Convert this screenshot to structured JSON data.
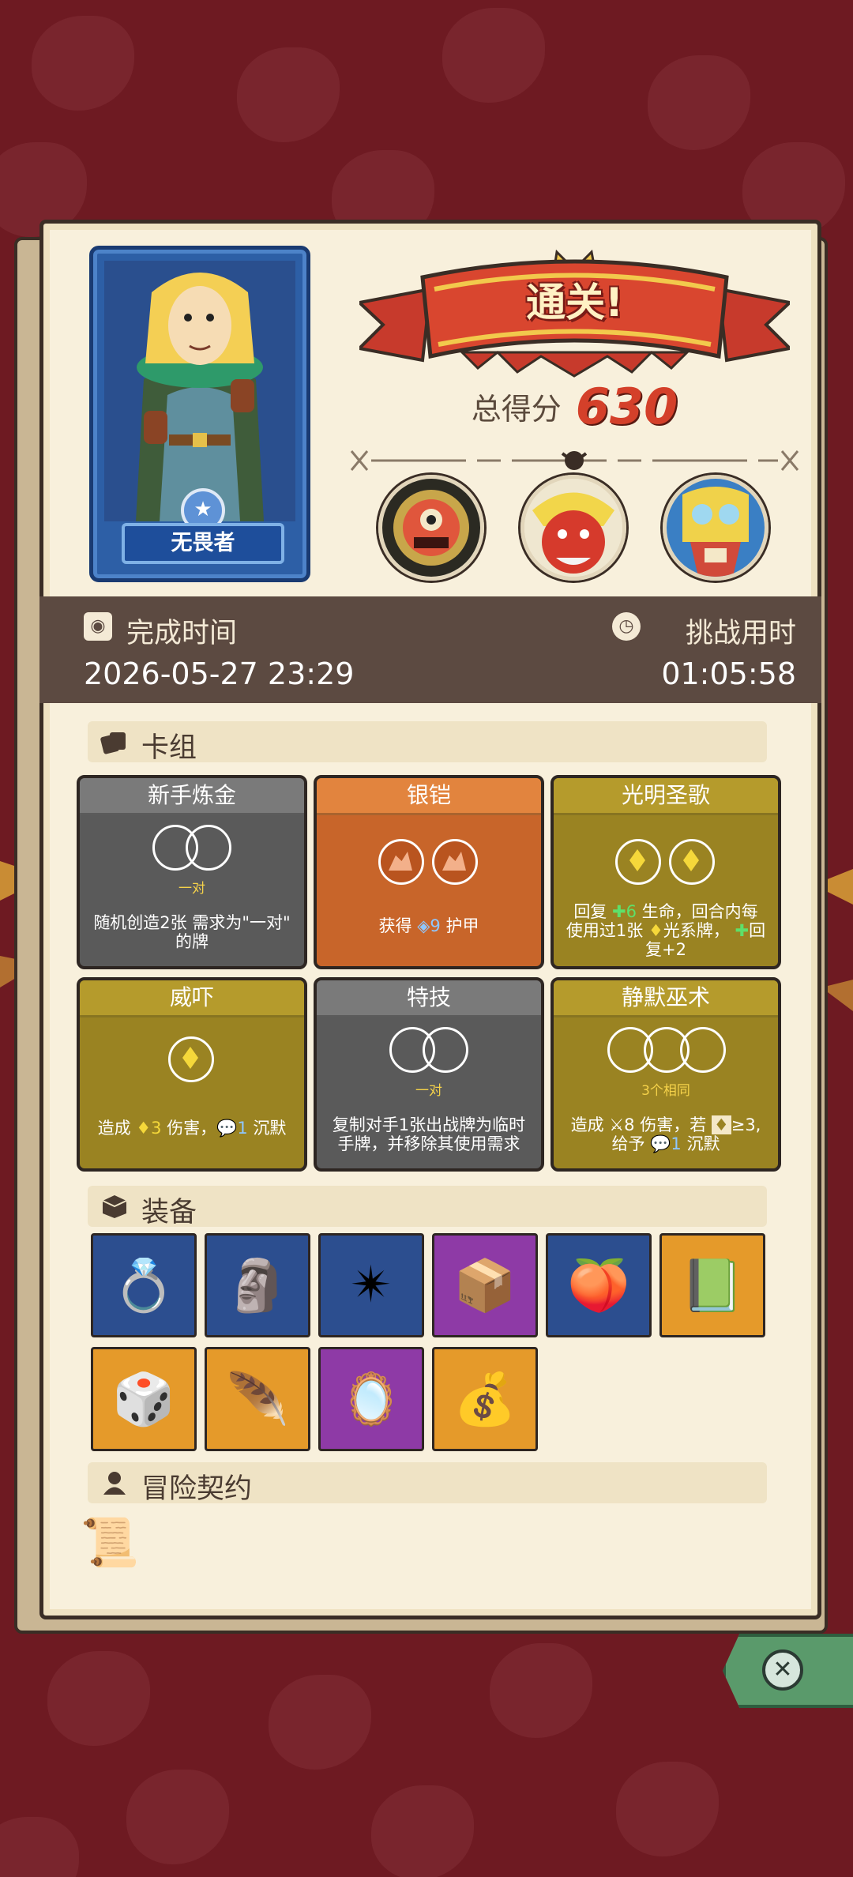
{
  "hero": {
    "name": "无畏者"
  },
  "header": {
    "banner": "通关!",
    "score_label": "总得分",
    "score_value": "630"
  },
  "bosses": [
    "boss-cyclops",
    "boss-red-demon",
    "boss-skull-mask"
  ],
  "times": {
    "complete_label": "完成时间",
    "complete_value": "2026-05-27 23:29",
    "duration_label": "挑战用时",
    "duration_value": "01:05:58"
  },
  "sections": {
    "deck": "卡组",
    "equipment": "装备",
    "contract": "冒险契约"
  },
  "cards": [
    {
      "title": "新手炼金",
      "sub": "一对",
      "desc_a": "随机创造2张 需求为\"一对\"",
      "desc_b": "的牌",
      "color": "gray"
    },
    {
      "title": "银铠",
      "desc_a": "获得 ",
      "desc_b_num": "9",
      "desc_c": " 护甲",
      "color": "orange"
    },
    {
      "title": "光明圣歌",
      "desc_a": "回复 ",
      "heal": "6",
      "desc_b": " 生命，回合内每",
      "desc_c": "使用过1张 ",
      "desc_d": "光系牌，",
      "desc_e": "回",
      "desc_f": "复+2",
      "color": "olive"
    },
    {
      "title": "威吓",
      "desc_a": "造成 ",
      "dmg": "3",
      "desc_b": " 伤害，",
      "silence": "1",
      "desc_c": " 沉默",
      "color": "olive"
    },
    {
      "title": "特技",
      "sub": "一对",
      "desc_a": "复制对手1张出战牌为临时",
      "desc_b": "手牌，并移除其使用需求",
      "color": "gray"
    },
    {
      "title": "静默巫术",
      "sub": "3个相同",
      "desc_a": "造成 ",
      "dmg": "8",
      "desc_b": " 伤害，若 ",
      "desc_c": "≥3,",
      "desc_d": "给予 ",
      "silence": "1",
      "desc_e": " 沉默",
      "color": "olive"
    }
  ],
  "equipment": [
    {
      "icon": "ring-icon",
      "glyph": "💍",
      "color": "blue"
    },
    {
      "icon": "totem-icon",
      "glyph": "🗿",
      "color": "blue"
    },
    {
      "icon": "compass-star-icon",
      "glyph": "✴",
      "color": "blue"
    },
    {
      "icon": "gold-block-icon",
      "glyph": "📦",
      "color": "purple"
    },
    {
      "icon": "fruit-pot-icon",
      "glyph": "🍑",
      "color": "blue"
    },
    {
      "icon": "moss-board-icon",
      "glyph": "📗",
      "color": "orange"
    },
    {
      "icon": "dice-icon",
      "glyph": "🎲",
      "color": "orange"
    },
    {
      "icon": "feather-icon",
      "glyph": "🪶",
      "color": "orange"
    },
    {
      "icon": "mirror-icon",
      "glyph": "🪞",
      "color": "purple"
    },
    {
      "icon": "coin-bag-icon",
      "glyph": "💰",
      "color": "orange"
    }
  ],
  "contracts": [
    {
      "icon": "scroll-icon",
      "glyph": "📜"
    }
  ],
  "colors": {
    "background": "#6e1a22",
    "parchment": "#f8f0dc",
    "score": "#d4402a"
  }
}
